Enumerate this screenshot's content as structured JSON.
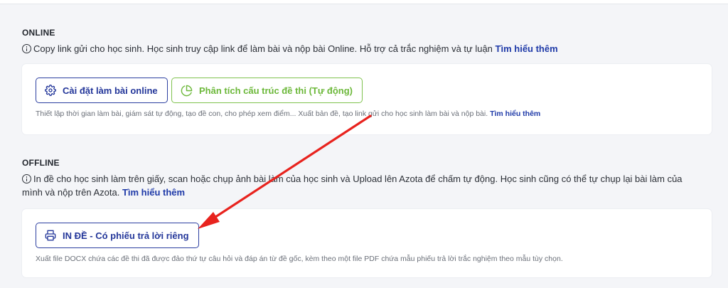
{
  "online": {
    "title": "ONLINE",
    "desc": "Copy link gửi cho học sinh. Học sinh truy cập link để làm bài và nộp bài Online. Hỗ trợ cả trắc nghiệm và tự luận",
    "desc_link": "Tìm hiểu thêm",
    "settings_button": "Cài đặt làm bài online",
    "analyze_button": "Phân tích cấu trúc đề thi (Tự động)",
    "note": "Thiết lập thời gian làm bài, giám sát tự động, tạo đề con, cho phép xem điểm... Xuất bản đề, tạo link gửi cho học sinh làm bài và nộp bài.",
    "note_link": "Tìm hiểu thêm"
  },
  "offline": {
    "title": "OFFLINE",
    "desc_line1": "In đề cho học sinh làm trên giấy, scan hoặc chụp ảnh bài làm của học sinh và Upload lên Azota để chấm tự động. Học sinh cũng có thể tự chụp lại bài làm của",
    "desc_line2": "mình và nộp trên Azota.",
    "desc_link": "Tìm hiểu thêm",
    "print_button": "IN ĐỀ - Có phiếu trả lời riêng",
    "note": "Xuất file DOCX chứa các đề thi đã được đảo thứ tự câu hỏi và đáp án từ đề gốc, kèm theo một file PDF chứa mẫu phiếu trả lời trắc nghiệm theo mẫu tùy chọn."
  },
  "colors": {
    "primary": "#24379a",
    "green": "#6cb83a",
    "arrow": "#e8231e",
    "background": "#f4f5f8"
  },
  "icons": {
    "info": "info-circle-icon",
    "settings": "gear-icon",
    "analyze": "pie-chart-icon",
    "print": "printer-icon"
  }
}
